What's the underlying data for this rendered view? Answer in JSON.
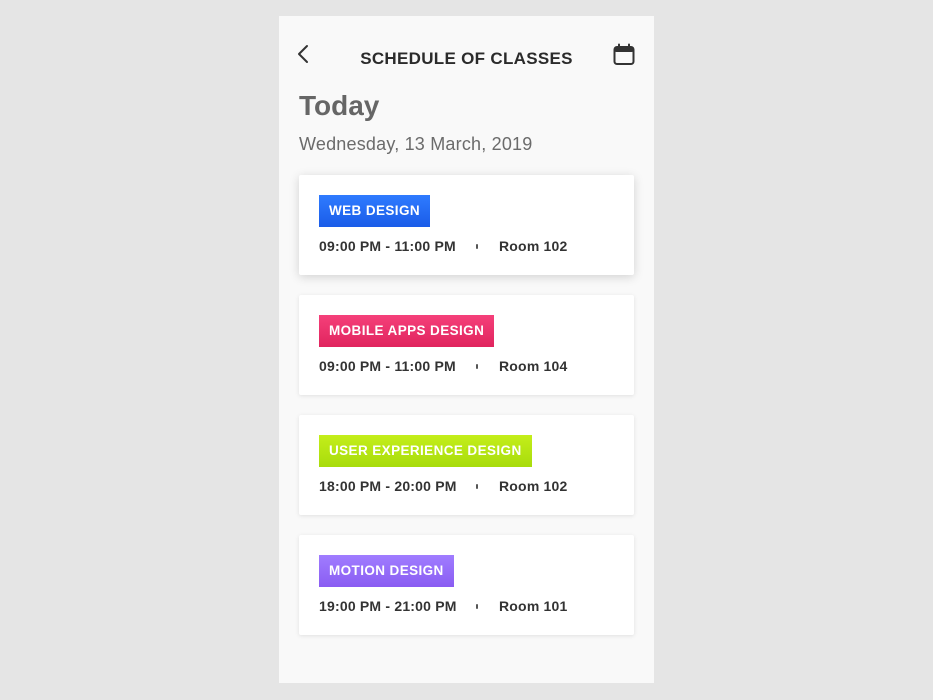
{
  "header": {
    "title": "SCHEDULE OF CLASSES",
    "back_icon": "chevron-left-icon",
    "calendar_icon": "calendar-icon"
  },
  "today": {
    "heading": "Today",
    "date": "Wednesday, 13 March, 2019"
  },
  "classes": [
    {
      "name": "WEB DESIGN",
      "time": "09:00 PM - 11:00 PM",
      "room": "Room 102",
      "color_from": "#2f7bff",
      "color_to": "#1a5ce8"
    },
    {
      "name": "MOBILE APPS DESIGN",
      "time": "09:00 PM - 11:00 PM",
      "room": "Room 104",
      "color_from": "#f5407a",
      "color_to": "#e0245e"
    },
    {
      "name": "USER EXPERIENCE DESIGN",
      "time": "18:00 PM - 20:00 PM",
      "room": "Room 102",
      "color_from": "#c4ee1a",
      "color_to": "#a8dc0c"
    },
    {
      "name": "MOTION DESIGN",
      "time": "19:00 PM - 21:00 PM",
      "room": "Room 101",
      "color_from": "#a07dff",
      "color_to": "#8a5cf2"
    }
  ]
}
